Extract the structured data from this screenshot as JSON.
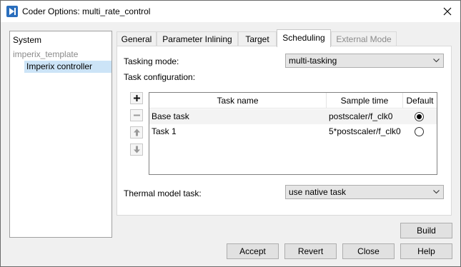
{
  "window": {
    "title": "Coder Options: multi_rate_control",
    "icon": "simulink-play-icon",
    "accent": "#2a6ebd"
  },
  "tree": {
    "items": [
      {
        "label": "System"
      },
      {
        "label": "imperix_template"
      },
      {
        "label": "Imperix controller",
        "selected": true
      }
    ]
  },
  "tabs": [
    {
      "label": "General"
    },
    {
      "label": "Parameter Inlining"
    },
    {
      "label": "Target"
    },
    {
      "label": "Scheduling",
      "active": true
    },
    {
      "label": "External Mode",
      "disabled": true
    }
  ],
  "scheduling": {
    "tasking_mode_label": "Tasking mode:",
    "tasking_mode_value": "multi-tasking",
    "task_config_label": "Task configuration:",
    "table": {
      "headers": [
        "Task name",
        "Sample time",
        "Default"
      ],
      "rows": [
        {
          "name": "Base task",
          "sample_time": "postscaler/f_clk0",
          "default": true
        },
        {
          "name": "Task 1",
          "sample_time": "5*postscaler/f_clk0",
          "default": false
        }
      ]
    },
    "side_buttons": [
      "add-icon",
      "remove-icon",
      "move-up-icon",
      "move-down-icon"
    ],
    "thermal_label": "Thermal model task:",
    "thermal_value": "use native task"
  },
  "buttons": {
    "build": "Build",
    "accept": "Accept",
    "revert": "Revert",
    "close": "Close",
    "help": "Help"
  }
}
